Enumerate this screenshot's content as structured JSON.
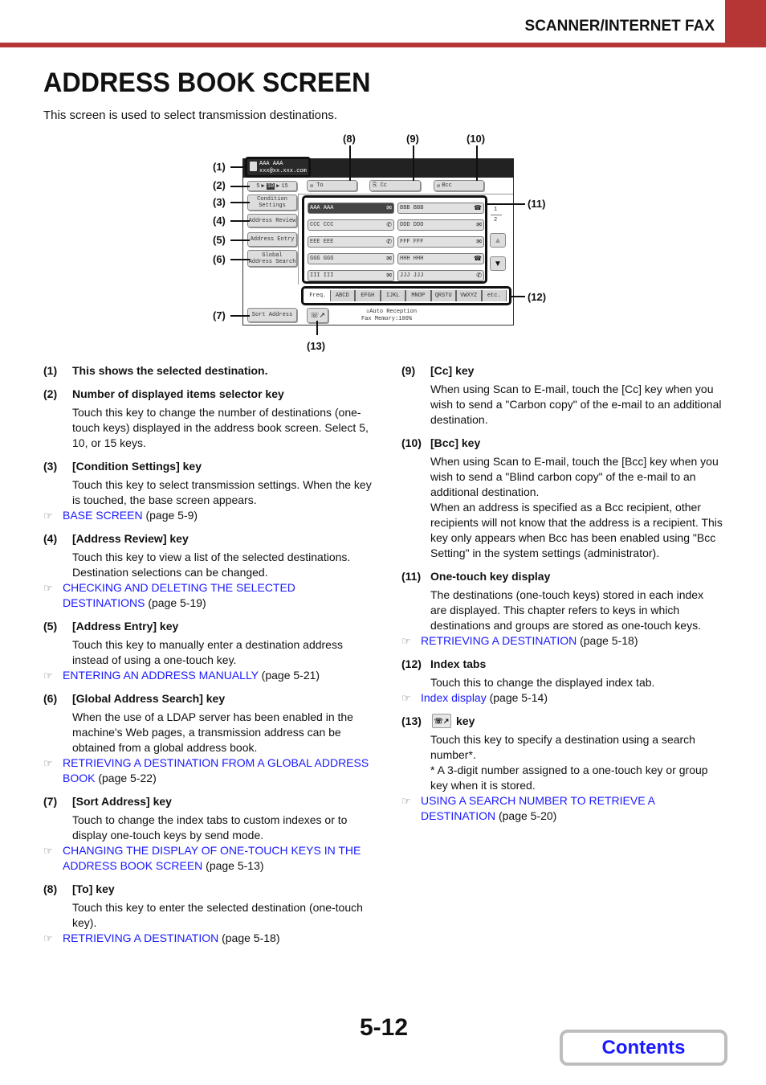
{
  "header": {
    "section": "SCANNER/INTERNET FAX",
    "accent_color": "#b63636"
  },
  "page_title": "ADDRESS BOOK SCREEN",
  "intro": "This screen is used to select transmission destinations.",
  "diagram": {
    "callouts": [
      "(1)",
      "(2)",
      "(3)",
      "(4)",
      "(5)",
      "(6)",
      "(7)",
      "(8)",
      "(9)",
      "(10)",
      "(11)",
      "(12)",
      "(13)"
    ],
    "selected_destination": {
      "name": "AAA AAA",
      "address": "xxx@xx.xxx.com"
    },
    "count_selector": {
      "options": [
        "5",
        "10",
        "15"
      ],
      "selected": "10"
    },
    "buttons": {
      "condition_settings": "Condition Settings",
      "address_review": "Address Review",
      "address_entry": "Address Entry",
      "global_search_line1": "Global",
      "global_search_line2": "Address Search",
      "sort_address": "Sort Address",
      "to": "To",
      "cc": "Cc",
      "bcc": "Bcc"
    },
    "one_touch_keys": [
      {
        "name": "AAA AAA",
        "icon": "email-icon",
        "glyph": "✉",
        "selected": true
      },
      {
        "name": "BBB BBB",
        "icon": "group-icon",
        "glyph": "☎",
        "selected": false
      },
      {
        "name": "CCC CCC",
        "icon": "phone-icon",
        "glyph": "✆",
        "selected": false
      },
      {
        "name": "DDD DDD",
        "icon": "email-icon",
        "glyph": "✉",
        "selected": false
      },
      {
        "name": "EEE EEE",
        "icon": "phone-icon",
        "glyph": "✆",
        "selected": false
      },
      {
        "name": "FFF FFF",
        "icon": "email-icon",
        "glyph": "✉",
        "selected": false
      },
      {
        "name": "GGG GGG",
        "icon": "email-icon",
        "glyph": "✉",
        "selected": false
      },
      {
        "name": "HHH HHH",
        "icon": "group-icon",
        "glyph": "☎",
        "selected": false
      },
      {
        "name": "III III",
        "icon": "email-icon",
        "glyph": "✉",
        "selected": false
      },
      {
        "name": "JJJ JJJ",
        "icon": "phone-icon",
        "glyph": "✆",
        "selected": false
      }
    ],
    "pages": {
      "current": "1",
      "total": "2"
    },
    "index_tabs": [
      "Freq.",
      "ABCD",
      "EFGH",
      "IJKL",
      "MNOP",
      "QRSTU",
      "VWXYZ",
      "etc."
    ],
    "active_tab": "Freq.",
    "status_line1": "Auto Reception",
    "status_line2": "Fax Memory:100%"
  },
  "items_left": [
    {
      "num": "(1)",
      "title": "This shows the selected destination.",
      "body": [],
      "ref": null
    },
    {
      "num": "(2)",
      "title": "Number of displayed items selector key",
      "body": [
        "Touch this key to change the number of destinations (one-touch keys) displayed in the address book screen. Select 5, 10, or 15 keys."
      ],
      "ref": null
    },
    {
      "num": "(3)",
      "title": "[Condition Settings] key",
      "body": [
        "Touch this key to select transmission settings. When the key is touched, the base screen appears."
      ],
      "ref": {
        "link": "BASE SCREEN",
        "page": "(page 5-9)"
      }
    },
    {
      "num": "(4)",
      "title": "[Address Review] key",
      "body": [
        "Touch this key to view a list of the selected destinations. Destination selections can be changed."
      ],
      "ref": {
        "link": "CHECKING AND DELETING THE SELECTED DESTINATIONS",
        "page": "(page 5-19)"
      }
    },
    {
      "num": "(5)",
      "title": "[Address Entry] key",
      "body": [
        "Touch this key to manually enter a destination address instead of using a one-touch key."
      ],
      "ref": {
        "link": "ENTERING AN ADDRESS MANUALLY",
        "page": "(page 5-21)"
      }
    },
    {
      "num": "(6)",
      "title": "[Global Address Search] key",
      "body": [
        "When the use of a LDAP server has been enabled in the machine's Web pages, a transmission address can be obtained from a global address book."
      ],
      "ref": {
        "link": "RETRIEVING A DESTINATION FROM A GLOBAL ADDRESS BOOK",
        "page": "(page 5-22)"
      }
    },
    {
      "num": "(7)",
      "title": "[Sort Address] key",
      "body": [
        "Touch to change the index tabs to custom indexes or to display one-touch keys by send mode."
      ],
      "ref": {
        "link": "CHANGING THE DISPLAY OF ONE-TOUCH KEYS IN THE ADDRESS BOOK SCREEN",
        "page": "(page 5-13)"
      }
    },
    {
      "num": "(8)",
      "title": "[To] key",
      "body": [
        "Touch this key to enter the selected destination (one-touch key)."
      ],
      "ref": {
        "link": "RETRIEVING A DESTINATION",
        "page": "(page 5-18)"
      }
    }
  ],
  "items_right": [
    {
      "num": "(9)",
      "title": "[Cc] key",
      "body": [
        "When using Scan to E-mail, touch the [Cc] key when you wish to send a \"Carbon copy\" of the e-mail to an additional destination."
      ],
      "ref": null
    },
    {
      "num": "(10)",
      "title": "[Bcc] key",
      "body": [
        "When using Scan to E-mail, touch the [Bcc] key when you wish to send a \"Blind carbon copy\" of the e-mail to an additional destination.",
        "When an address is specified as a Bcc recipient, other recipients will not know that the address is a recipient. This key only appears when Bcc has been enabled using \"Bcc Setting\" in the system settings (administrator)."
      ],
      "ref": null
    },
    {
      "num": "(11)",
      "title": "One-touch key display",
      "body": [
        "The destinations (one-touch keys) stored in each index are displayed. This chapter refers to keys in which destinations and groups are stored as one-touch keys."
      ],
      "ref": {
        "link": "RETRIEVING A DESTINATION",
        "page": "(page 5-18)"
      }
    },
    {
      "num": "(12)",
      "title": "Index tabs",
      "body": [
        "Touch this to change the displayed index tab."
      ],
      "ref": {
        "link": "Index display",
        "page": "(page 5-14)"
      }
    },
    {
      "num": "(13)",
      "title": "key",
      "title_icon": "search-number-key-icon",
      "body": [
        "Touch this key to specify a destination using a search number*.",
        "* A 3-digit number assigned to a one-touch key or group key when it is stored."
      ],
      "ref": {
        "link": "USING A SEARCH NUMBER TO RETRIEVE A DESTINATION",
        "page": "(page 5-20)"
      }
    }
  ],
  "footer": {
    "page_number": "5-12",
    "contents_label": "Contents"
  }
}
